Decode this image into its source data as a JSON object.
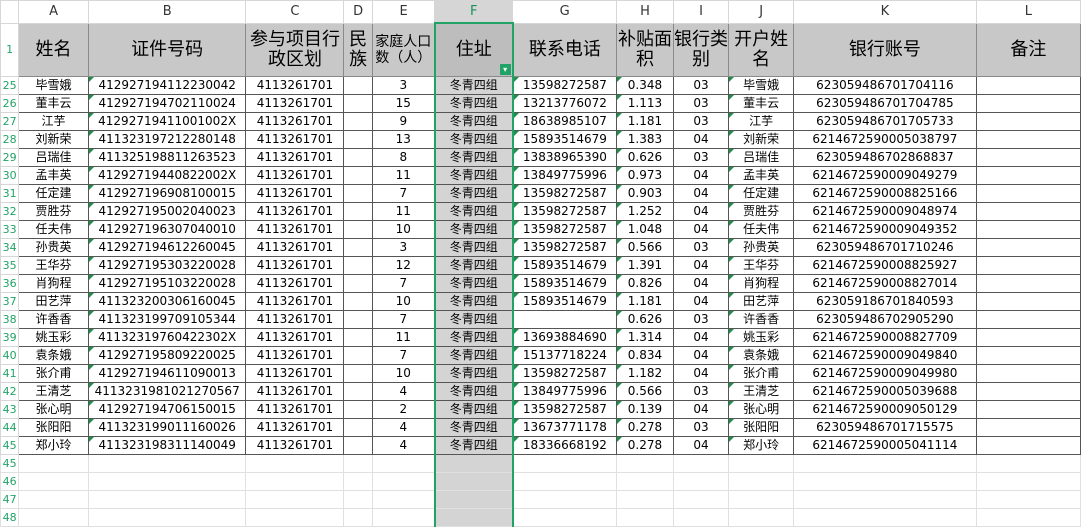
{
  "columns": [
    "A",
    "B",
    "C",
    "D",
    "E",
    "F",
    "G",
    "H",
    "I",
    "J",
    "K",
    "L"
  ],
  "header": {
    "row_number": "1",
    "cells": [
      "姓名",
      "证件号码",
      "参与项目行政区划",
      "民族",
      "家庭人口数（人）",
      "住址",
      "联系电话",
      "补贴面积",
      "银行类别",
      "开户姓名",
      "银行账号",
      "备注"
    ],
    "filter_icon": "filter-icon"
  },
  "rows": [
    {
      "n": "25",
      "name": "毕雪娥",
      "id": "412927194112230042",
      "region": "4113261701",
      "eth": "",
      "pop": "3",
      "addr": "冬青四组",
      "phone": "13598272587",
      "area": "0.348",
      "bank": "03",
      "acct_name": "毕雪娥",
      "acct": "623059486701704116",
      "note": ""
    },
    {
      "n": "26",
      "name": "董丰云",
      "id": "412927194702110024",
      "region": "4113261701",
      "eth": "",
      "pop": "15",
      "addr": "冬青四组",
      "phone": "13213776072",
      "area": "1.113",
      "bank": "03",
      "acct_name": "董丰云",
      "acct": "623059486701704785",
      "note": ""
    },
    {
      "n": "27",
      "name": "江芋",
      "id": "41292719411001002X",
      "region": "4113261701",
      "eth": "",
      "pop": "9",
      "addr": "冬青四组",
      "phone": "18638985107",
      "area": "1.181",
      "bank": "03",
      "acct_name": "江芋",
      "acct": "623059486701705733",
      "note": ""
    },
    {
      "n": "28",
      "name": "刘新荣",
      "id": "411323197212280148",
      "region": "4113261701",
      "eth": "",
      "pop": "13",
      "addr": "冬青四组",
      "phone": "15893514679",
      "area": "1.383",
      "bank": "04",
      "acct_name": "刘新荣",
      "acct": "6214672590005038797",
      "note": ""
    },
    {
      "n": "29",
      "name": "吕瑞佳",
      "id": "411325198811263523",
      "region": "4113261701",
      "eth": "",
      "pop": "8",
      "addr": "冬青四组",
      "phone": "13838965390",
      "area": "0.626",
      "bank": "03",
      "acct_name": "吕瑞佳",
      "acct": "623059486702868837",
      "note": ""
    },
    {
      "n": "30",
      "name": "孟丰英",
      "id": "41292719440822002X",
      "region": "4113261701",
      "eth": "",
      "pop": "11",
      "addr": "冬青四组",
      "phone": "13849775996",
      "area": "0.973",
      "bank": "04",
      "acct_name": "孟丰英",
      "acct": "6214672590009049279",
      "note": ""
    },
    {
      "n": "31",
      "name": "任定建",
      "id": "412927196908100015",
      "region": "4113261701",
      "eth": "",
      "pop": "7",
      "addr": "冬青四组",
      "phone": "13598272587",
      "area": "0.903",
      "bank": "04",
      "acct_name": "任定建",
      "acct": "6214672590008825166",
      "note": ""
    },
    {
      "n": "32",
      "name": "贾胜芬",
      "id": "412927195002040023",
      "region": "4113261701",
      "eth": "",
      "pop": "11",
      "addr": "冬青四组",
      "phone": "13598272587",
      "area": "1.252",
      "bank": "04",
      "acct_name": "贾胜芬",
      "acct": "6214672590009048974",
      "note": ""
    },
    {
      "n": "33",
      "name": "任夫伟",
      "id": "412927196307040010",
      "region": "4113261701",
      "eth": "",
      "pop": "10",
      "addr": "冬青四组",
      "phone": "13598272587",
      "area": "1.048",
      "bank": "04",
      "acct_name": "任夫伟",
      "acct": "6214672590009049352",
      "note": ""
    },
    {
      "n": "34",
      "name": "孙贵英",
      "id": "412927194612260045",
      "region": "4113261701",
      "eth": "",
      "pop": "3",
      "addr": "冬青四组",
      "phone": "13598272587",
      "area": "0.566",
      "bank": "03",
      "acct_name": "孙贵英",
      "acct": "623059486701710246",
      "note": ""
    },
    {
      "n": "35",
      "name": "王华芬",
      "id": "412927195303220028",
      "region": "4113261701",
      "eth": "",
      "pop": "12",
      "addr": "冬青四组",
      "phone": "15893514679",
      "area": "1.391",
      "bank": "04",
      "acct_name": "王华芬",
      "acct": "6214672590008825927",
      "note": ""
    },
    {
      "n": "36",
      "name": "肖狗程",
      "id": "412927195103220028",
      "region": "4113261701",
      "eth": "",
      "pop": "7",
      "addr": "冬青四组",
      "phone": "15893514679",
      "area": "0.826",
      "bank": "04",
      "acct_name": "肖狗程",
      "acct": "6214672590008827014",
      "note": ""
    },
    {
      "n": "37",
      "name": "田艺萍",
      "id": "411323200306160045",
      "region": "4113261701",
      "eth": "",
      "pop": "10",
      "addr": "冬青四组",
      "phone": "15893514679",
      "area": "1.181",
      "bank": "04",
      "acct_name": "田艺萍",
      "acct": "623059186701840593",
      "note": ""
    },
    {
      "n": "38",
      "name": "许香香",
      "id": "411323199709105344",
      "region": "4113261701",
      "eth": "",
      "pop": "7",
      "addr": "冬青四组",
      "phone": "",
      "area": "0.626",
      "bank": "03",
      "acct_name": "许香香",
      "acct": "623059486702905290",
      "note": ""
    },
    {
      "n": "39",
      "name": "姚玉彩",
      "id": "41132319760422302X",
      "region": "4113261701",
      "eth": "",
      "pop": "11",
      "addr": "冬青四组",
      "phone": "13693884690",
      "area": "1.314",
      "bank": "04",
      "acct_name": "姚玉彩",
      "acct": "6214672590008827709",
      "note": ""
    },
    {
      "n": "40",
      "name": "袁条娥",
      "id": "412927195809220025",
      "region": "4113261701",
      "eth": "",
      "pop": "7",
      "addr": "冬青四组",
      "phone": "15137718224",
      "area": "0.834",
      "bank": "04",
      "acct_name": "袁条娥",
      "acct": "6214672590009049840",
      "note": ""
    },
    {
      "n": "41",
      "name": "张介甫",
      "id": "412927194611090013",
      "region": "4113261701",
      "eth": "",
      "pop": "10",
      "addr": "冬青四组",
      "phone": "13598272587",
      "area": "1.182",
      "bank": "04",
      "acct_name": "张介甫",
      "acct": "6214672590009049980",
      "note": ""
    },
    {
      "n": "42",
      "name": "王清芝",
      "id": "4113231981021270567",
      "region": "4113261701",
      "eth": "",
      "pop": "4",
      "addr": "冬青四组",
      "phone": "13849775996",
      "area": "0.566",
      "bank": "03",
      "acct_name": "王清芝",
      "acct": "6214672590005039688",
      "note": ""
    },
    {
      "n": "43",
      "name": "张心明",
      "id": "412927194706150015",
      "region": "4113261701",
      "eth": "",
      "pop": "2",
      "addr": "冬青四组",
      "phone": "13598272587",
      "area": "0.139",
      "bank": "04",
      "acct_name": "张心明",
      "acct": "6214672590009050129",
      "note": ""
    },
    {
      "n": "44",
      "name": "张阳阳",
      "id": "411323199011160026",
      "region": "4113261701",
      "eth": "",
      "pop": "4",
      "addr": "冬青四组",
      "phone": "13673771178",
      "area": "0.278",
      "bank": "03",
      "acct_name": "张阳阳",
      "acct": "623059486701715575",
      "note": ""
    },
    {
      "n": "45",
      "name": "郑小玲",
      "id": "411323198311140049",
      "region": "4113261701",
      "eth": "",
      "pop": "4",
      "addr": "冬青四组",
      "phone": "18336668192",
      "area": "0.278",
      "bank": "04",
      "acct_name": "郑小玲",
      "acct": "6214672590005041114",
      "note": ""
    }
  ],
  "empty_rows": [
    "45",
    "46",
    "47",
    "48"
  ]
}
